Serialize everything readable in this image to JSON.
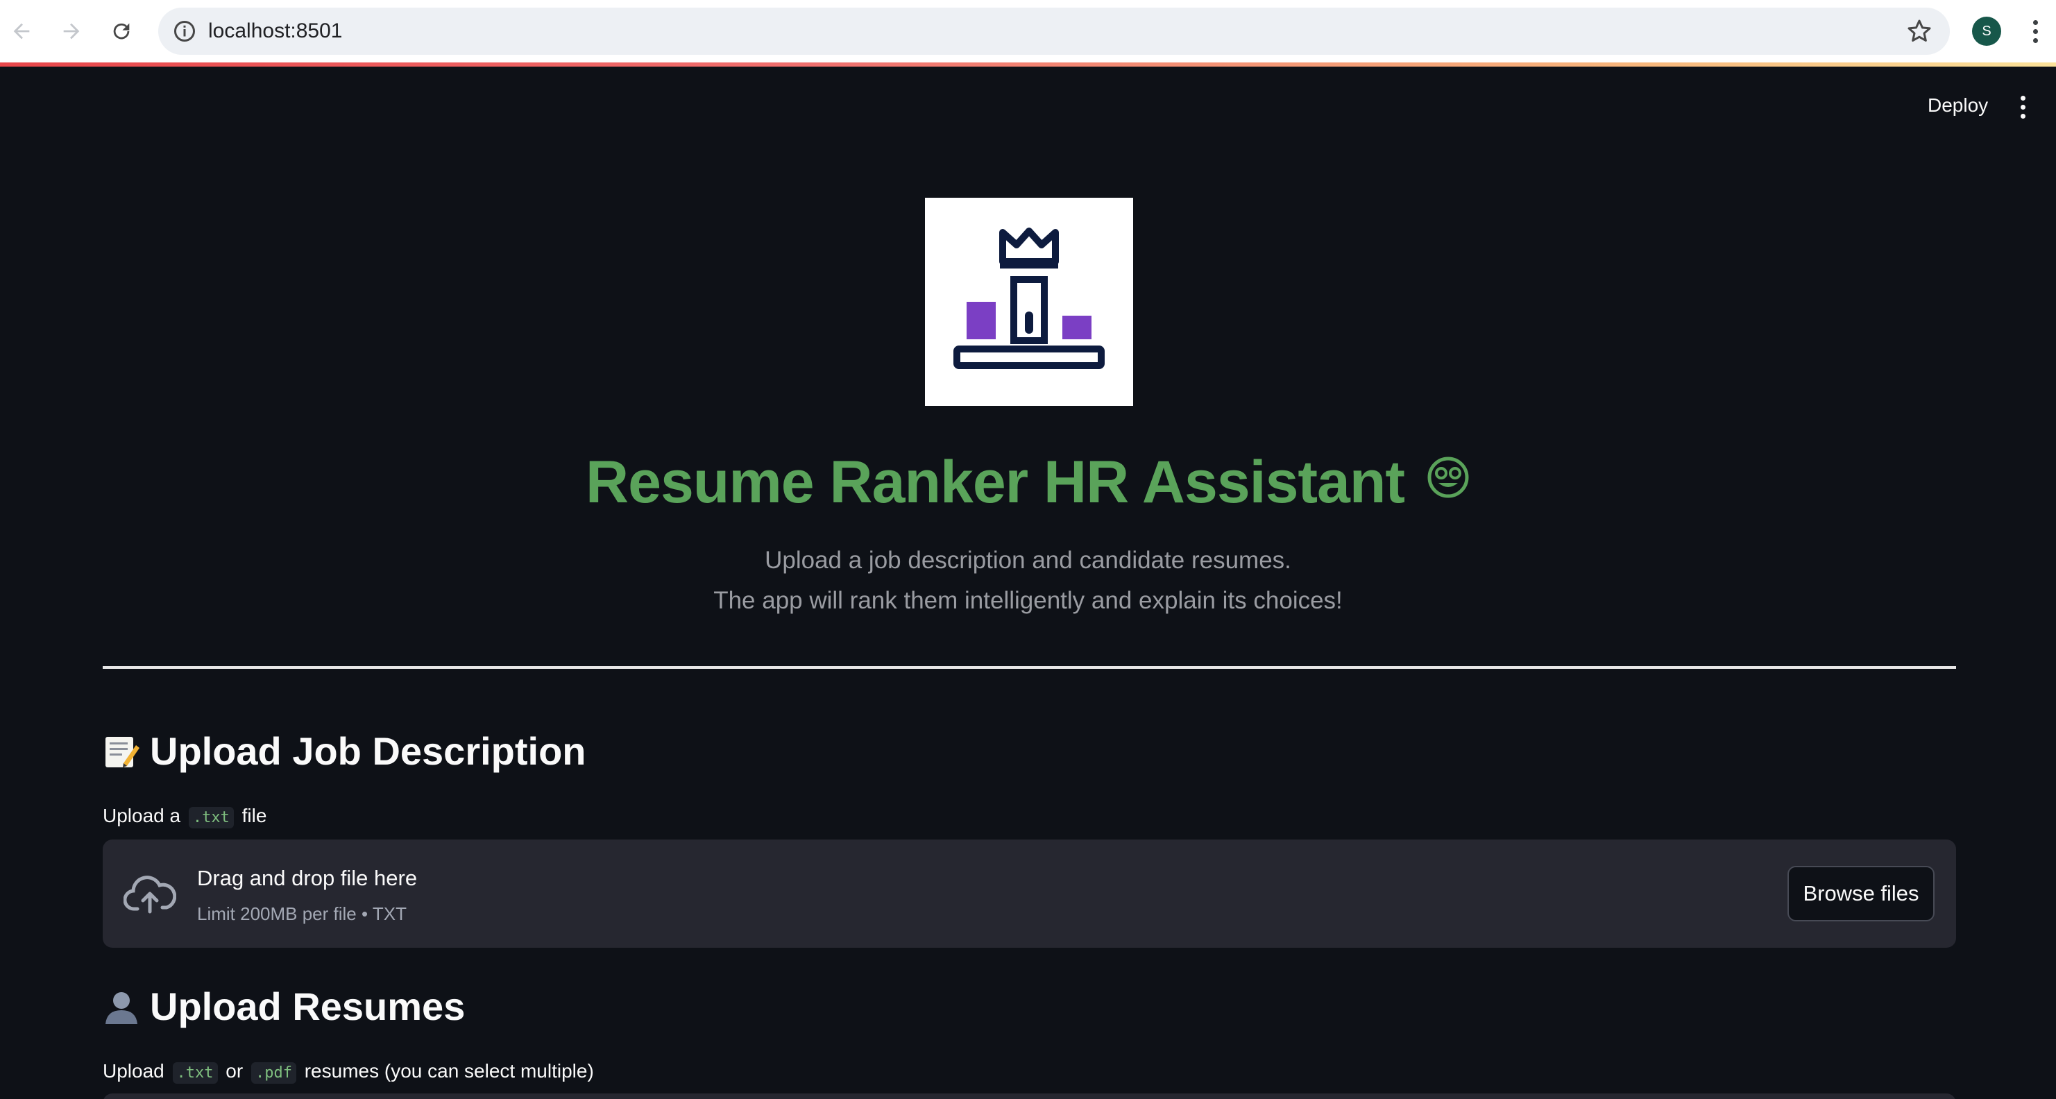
{
  "browser": {
    "url": "localhost:8501",
    "profile_initial": "S"
  },
  "toolbar": {
    "deploy_label": "Deploy"
  },
  "hero": {
    "title": "Resume Ranker HR Assistant",
    "title_emoji": "nerd-face-emoji",
    "subtitle_line1": "Upload a job description and candidate resumes.",
    "subtitle_line2": "The app will rank them intelligently and explain its choices!",
    "logo_icon": "podium-crown-icon",
    "colors": {
      "title": "#5aa35a",
      "logo_navy": "#0d1b3e",
      "logo_purple": "#7b3fc4"
    }
  },
  "job_section": {
    "heading": "Upload Job Description",
    "heading_icon": "memo-emoji",
    "label_prefix": "Upload a",
    "label_code": ".txt",
    "label_suffix": "file",
    "uploader": {
      "title": "Drag and drop file here",
      "limit": "Limit 200MB per file • TXT",
      "button": "Browse files"
    }
  },
  "resume_section": {
    "heading": "Upload Resumes",
    "heading_icon": "bust-in-silhouette-emoji",
    "label_prefix": "Upload",
    "label_code1": ".txt",
    "label_or": "or",
    "label_code2": ".pdf",
    "label_suffix": "resumes (you can select multiple)"
  }
}
